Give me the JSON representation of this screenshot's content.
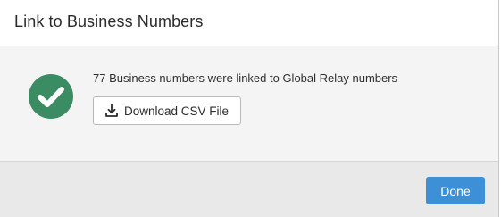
{
  "dialog": {
    "title": "Link to Business Numbers"
  },
  "result": {
    "status_icon": "check-circle-icon",
    "status_color": "#3b8c62",
    "message": "77 Business numbers were linked to Global Relay numbers"
  },
  "download_button": {
    "icon": "download-icon",
    "label": "Download CSV File"
  },
  "footer": {
    "done_label": "Done",
    "done_color": "#3d8fd6"
  }
}
